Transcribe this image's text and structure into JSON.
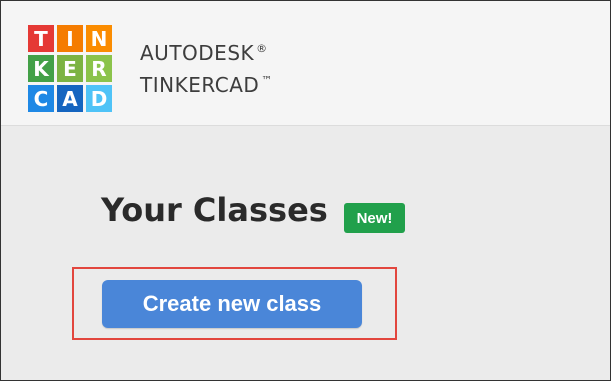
{
  "header": {
    "logo_tiles": [
      {
        "letter": "T",
        "color": "#e53935"
      },
      {
        "letter": "I",
        "color": "#f57c00"
      },
      {
        "letter": "N",
        "color": "#fb8c00"
      },
      {
        "letter": "K",
        "color": "#43a047"
      },
      {
        "letter": "E",
        "color": "#7cb342"
      },
      {
        "letter": "R",
        "color": "#8bc34a"
      },
      {
        "letter": "C",
        "color": "#1e88e5"
      },
      {
        "letter": "A",
        "color": "#1565c0"
      },
      {
        "letter": "D",
        "color": "#4fc3f7"
      }
    ],
    "brand_line1": "AUTODESK",
    "brand_line1_mark": "®",
    "brand_line2": "TINKERCAD",
    "brand_line2_mark": "™"
  },
  "main": {
    "title": "Your Classes",
    "badge": "New!",
    "create_button_label": "Create new class"
  },
  "colors": {
    "badge_green": "#21a04b",
    "button_blue": "#4a86d8",
    "highlight_red": "#e2463e"
  }
}
